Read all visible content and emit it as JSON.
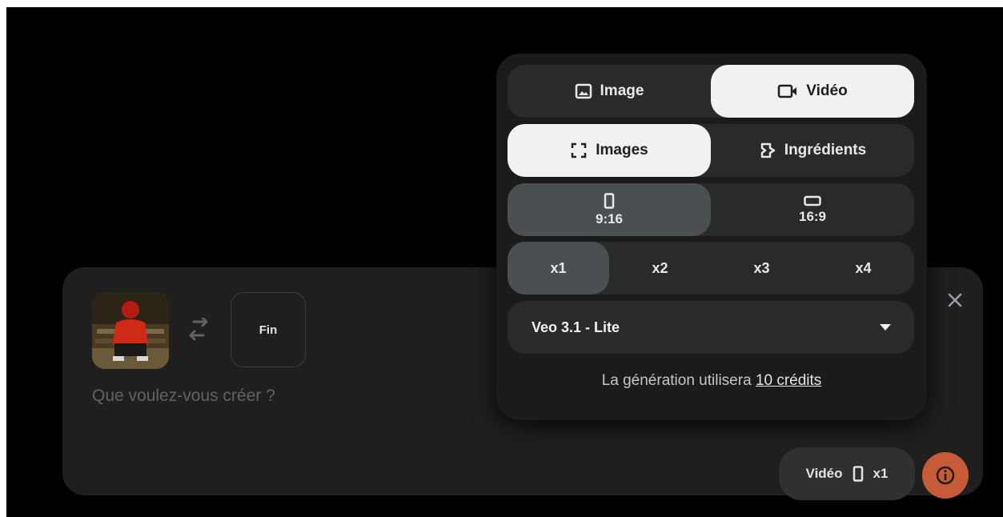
{
  "composer": {
    "end_frame_label": "Fin",
    "prompt_placeholder": "Que voulez-vous créer ?",
    "settings_chip": {
      "mode": "Vidéo",
      "count": "x1",
      "orientation_icon": "portrait-icon"
    }
  },
  "popover": {
    "type_tabs": [
      {
        "label": "Image",
        "icon": "image-icon",
        "selected": false
      },
      {
        "label": "Vidéo",
        "icon": "video-icon",
        "selected": true
      }
    ],
    "source_tabs": [
      {
        "label": "Images",
        "icon": "frame-icon",
        "selected": true
      },
      {
        "label": "Ingrédients",
        "icon": "ingredients-icon",
        "selected": false
      }
    ],
    "aspect_ratios": [
      {
        "label": "9:16",
        "icon": "portrait-icon",
        "selected": true
      },
      {
        "label": "16:9",
        "icon": "landscape-icon",
        "selected": false
      }
    ],
    "counts": [
      {
        "label": "x1",
        "selected": true
      },
      {
        "label": "x2",
        "selected": false
      },
      {
        "label": "x3",
        "selected": false
      },
      {
        "label": "x4",
        "selected": false
      }
    ],
    "model": "Veo 3.1 - Lite",
    "credit_text": "La génération utilisera",
    "credit_link": "10 crédits"
  },
  "colors": {
    "background": "#000000",
    "panel": "#1f1f1f",
    "selected_light": "#f1f1f1",
    "selected_grey": "#4a4f52",
    "submit_accent": "#c75a37"
  }
}
